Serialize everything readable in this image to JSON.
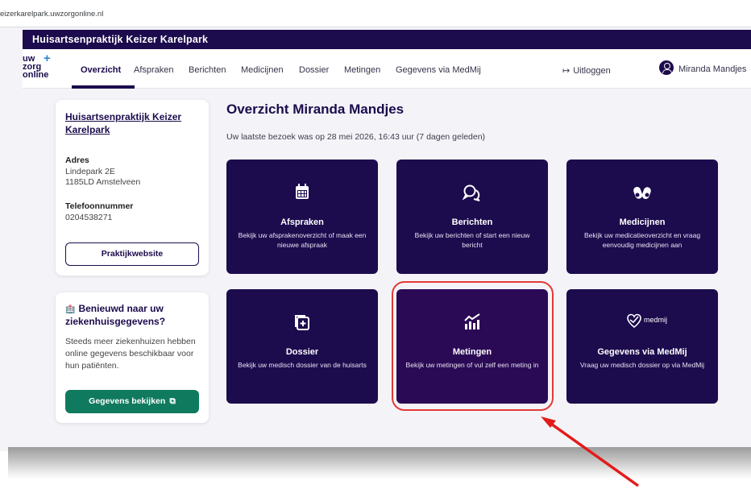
{
  "browser": {
    "url": "eizerkarelpark.uwzorgonline.nl"
  },
  "brand": {
    "title": "Huisartsenpraktijk Keizer Karelpark"
  },
  "logo": {
    "line1": "uw",
    "line2": "zorg",
    "line3": "online",
    "plus": "+"
  },
  "nav": {
    "items": [
      "Overzicht",
      "Afspraken",
      "Berichten",
      "Medicijnen",
      "Dossier",
      "Metingen",
      "Gegevens via MedMij"
    ],
    "active": "Overzicht",
    "logout": "Uitloggen",
    "user": "Miranda Mandjes"
  },
  "practice": {
    "name": "Huisartsenpraktijk Keizer Karelpark",
    "address_label": "Adres",
    "address_line1": "Lindepark 2E",
    "address_line2": "1185LD Amstelveen",
    "phone_label": "Telefoonnummer",
    "phone": "0204538271",
    "website_button": "Praktijkwebsite"
  },
  "hospital": {
    "title": "Benieuwd naar uw ziekenhuisgegevens?",
    "body": "Steeds meer ziekenhuizen hebben online gegevens beschikbaar voor hun patiënten.",
    "button": "Gegevens bekijken"
  },
  "main": {
    "heading": "Overzicht Miranda Mandjes",
    "last_visit": "Uw laatste bezoek was op 28 mei 2026, 16:43 uur (7 dagen geleden)"
  },
  "tiles": [
    {
      "title": "Afspraken",
      "desc": "Bekijk uw afsprakenoverzicht of maak een nieuwe afspraak",
      "icon": "calendar-icon"
    },
    {
      "title": "Berichten",
      "desc": "Bekijk uw berichten of start een nieuw bericht",
      "icon": "chat-icon"
    },
    {
      "title": "Medicijnen",
      "desc": "Bekijk uw medicatieoverzicht en vraag eenvoudig medicijnen aan",
      "icon": "pills-icon"
    },
    {
      "title": "Dossier",
      "desc": "Bekijk uw medisch dossier van de huisarts",
      "icon": "dossier-icon"
    },
    {
      "title": "Metingen",
      "desc": "Bekijk uw metingen of vul zelf een meting in",
      "icon": "chart-icon"
    },
    {
      "title": "Gegevens via MedMij",
      "desc": "Vraag uw medisch dossier op via MedMij",
      "icon": "medmij-icon",
      "logo_text": "medmij"
    }
  ],
  "colors": {
    "brand": "#1c0b4d",
    "accent_green": "#0f7a5e",
    "highlight_red": "#e53935",
    "logo_plus": "#2a8ad4"
  }
}
